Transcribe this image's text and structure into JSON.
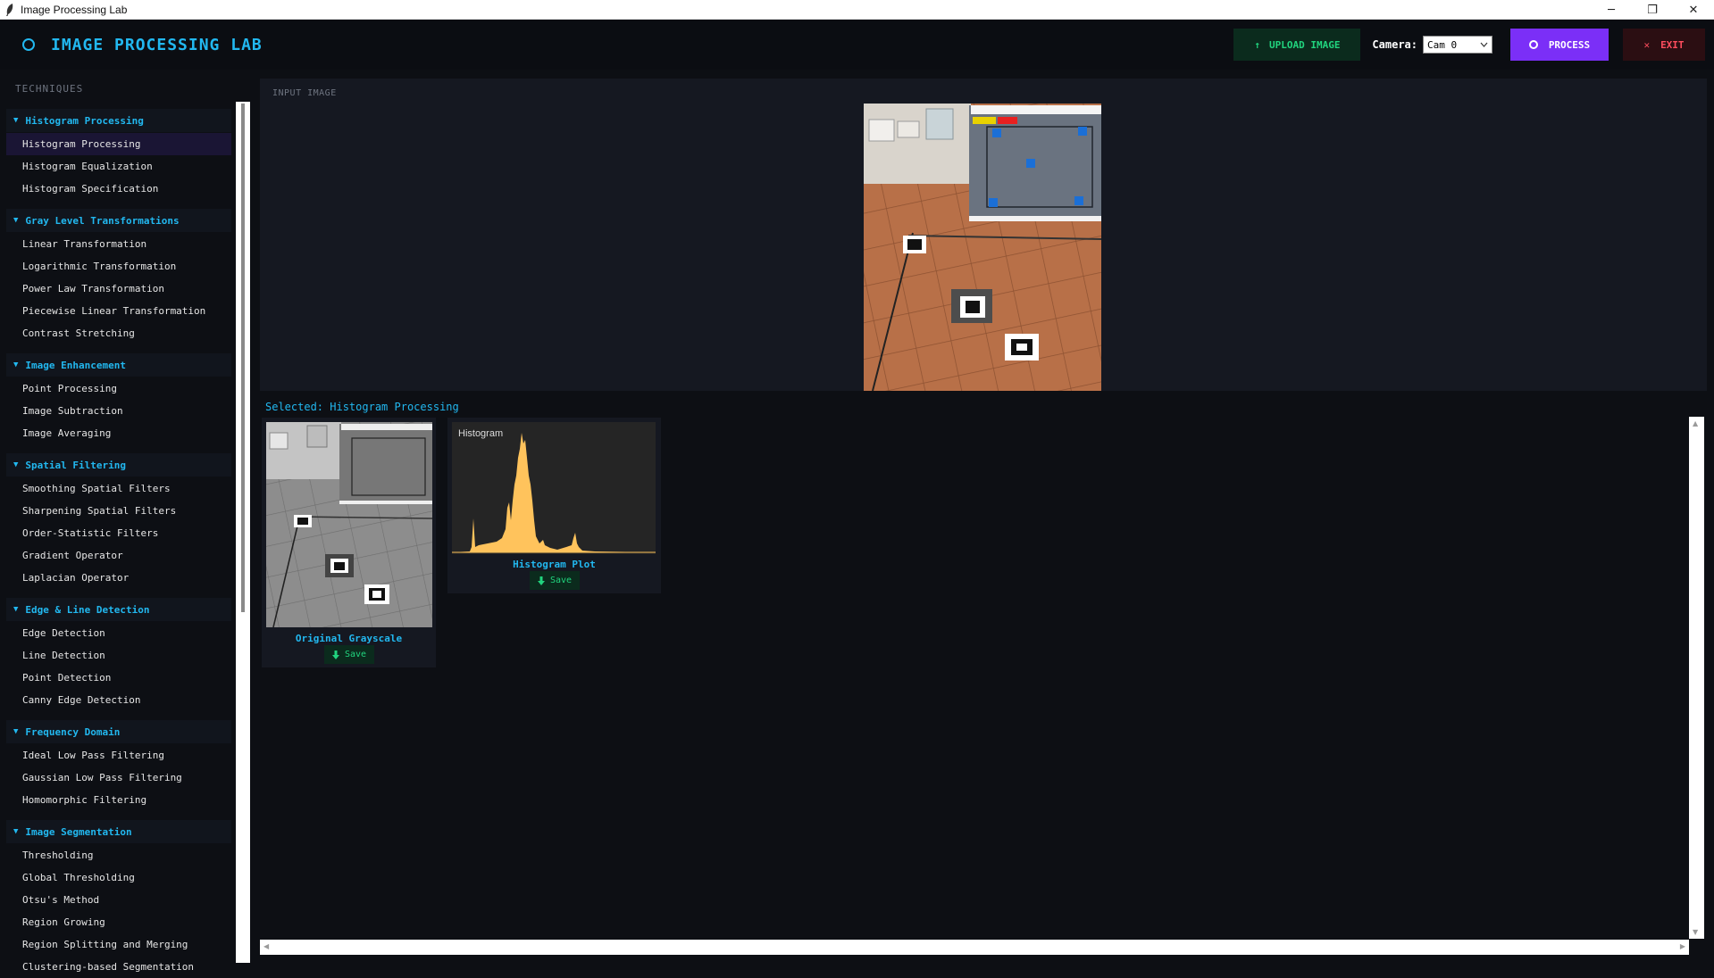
{
  "window": {
    "title": "Image Processing Lab",
    "minimize": "─",
    "restore": "❐",
    "close": "✕"
  },
  "header": {
    "title": "IMAGE PROCESSING LAB",
    "upload_label": "UPLOAD IMAGE",
    "upload_icon": "↑",
    "camera_label": "Camera:",
    "camera_value": "Cam 0",
    "process_label": "PROCESS",
    "exit_label": "EXIT",
    "exit_icon": "✕"
  },
  "sidebar": {
    "heading": "TECHNIQUES",
    "groups": [
      {
        "title": "Histogram Processing",
        "items": [
          "Histogram Processing",
          "Histogram Equalization",
          "Histogram Specification"
        ]
      },
      {
        "title": "Gray Level Transformations",
        "items": [
          "Linear Transformation",
          "Logarithmic Transformation",
          "Power Law Transformation",
          "Piecewise Linear Transformation",
          "Contrast Stretching"
        ]
      },
      {
        "title": "Image Enhancement",
        "items": [
          "Point Processing",
          "Image Subtraction",
          "Image Averaging"
        ]
      },
      {
        "title": "Spatial Filtering",
        "items": [
          "Smoothing Spatial Filters",
          "Sharpening Spatial Filters",
          "Order-Statistic Filters",
          "Gradient Operator",
          "Laplacian Operator"
        ]
      },
      {
        "title": "Edge & Line Detection",
        "items": [
          "Edge Detection",
          "Line Detection",
          "Point Detection",
          "Canny Edge Detection"
        ]
      },
      {
        "title": "Frequency Domain",
        "items": [
          "Ideal Low Pass Filtering",
          "Gaussian Low Pass Filtering",
          "Homomorphic Filtering"
        ]
      },
      {
        "title": "Image Segmentation",
        "items": [
          "Thresholding",
          "Global Thresholding",
          "Otsu's Method",
          "Region Growing",
          "Region Splitting and Merging",
          "Clustering-based Segmentation"
        ]
      }
    ],
    "active_item": "Histogram Processing"
  },
  "main": {
    "input_label": "INPUT IMAGE",
    "selected_text": "Selected: Histogram Processing",
    "results": [
      {
        "caption": "Original Grayscale",
        "save_label": "Save"
      },
      {
        "caption": "Histogram Plot",
        "save_label": "Save",
        "plot_title": "Histogram"
      }
    ]
  },
  "colors": {
    "accent": "#22b8f0",
    "process": "#7b2ff7",
    "upload_text": "#21d47e",
    "exit_text": "#ff4d5e",
    "histogram_fill": "#ffc35c"
  }
}
